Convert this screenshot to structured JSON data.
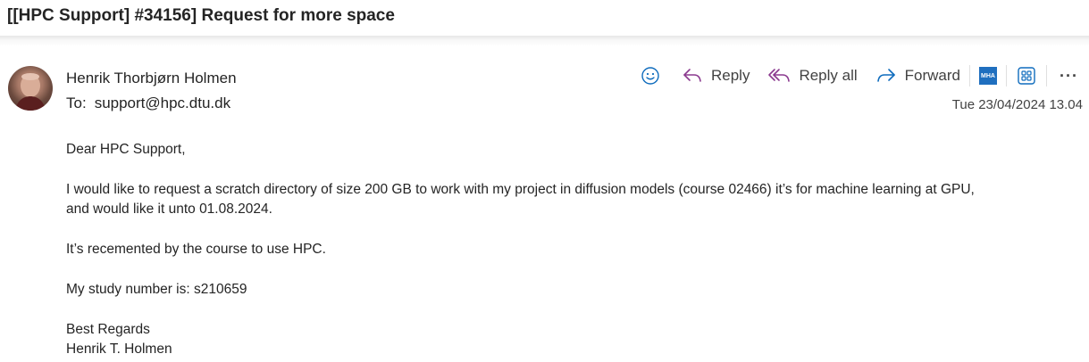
{
  "email": {
    "subject": "[[HPC Support] #34156] Request for more space",
    "sender_name": "Henrik Thorbjørn Holmen",
    "to_label": "To:",
    "to_address": "support@hpc.dtu.dk",
    "timestamp": "Tue 23/04/2024 13.04",
    "body": {
      "greeting": "Dear HPC Support,",
      "para1_line1": "I would like to request a scratch directory of size 200 GB to work with my project in diffusion models (course 02466) it’s for machine learning at GPU,",
      "para1_line2": "and would like it unto 01.08.2024.",
      "para2": "It’s recemented by the course to use HPC.",
      "para3": "My study number is: s210659",
      "closing": "Best Regards",
      "signature": "Henrik T. Holmen"
    }
  },
  "toolbar": {
    "emoji_icon": "smiley-icon",
    "reply_label": "Reply",
    "reply_all_label": "Reply all",
    "forward_label": "Forward",
    "mha_label": "MHA",
    "apps_icon": "apps-grid-icon",
    "more_label": "···"
  },
  "colors": {
    "accent": "#0f6cbd",
    "reply_arrow": "#8b3a8f",
    "mha_blue": "#1f6fbf"
  }
}
